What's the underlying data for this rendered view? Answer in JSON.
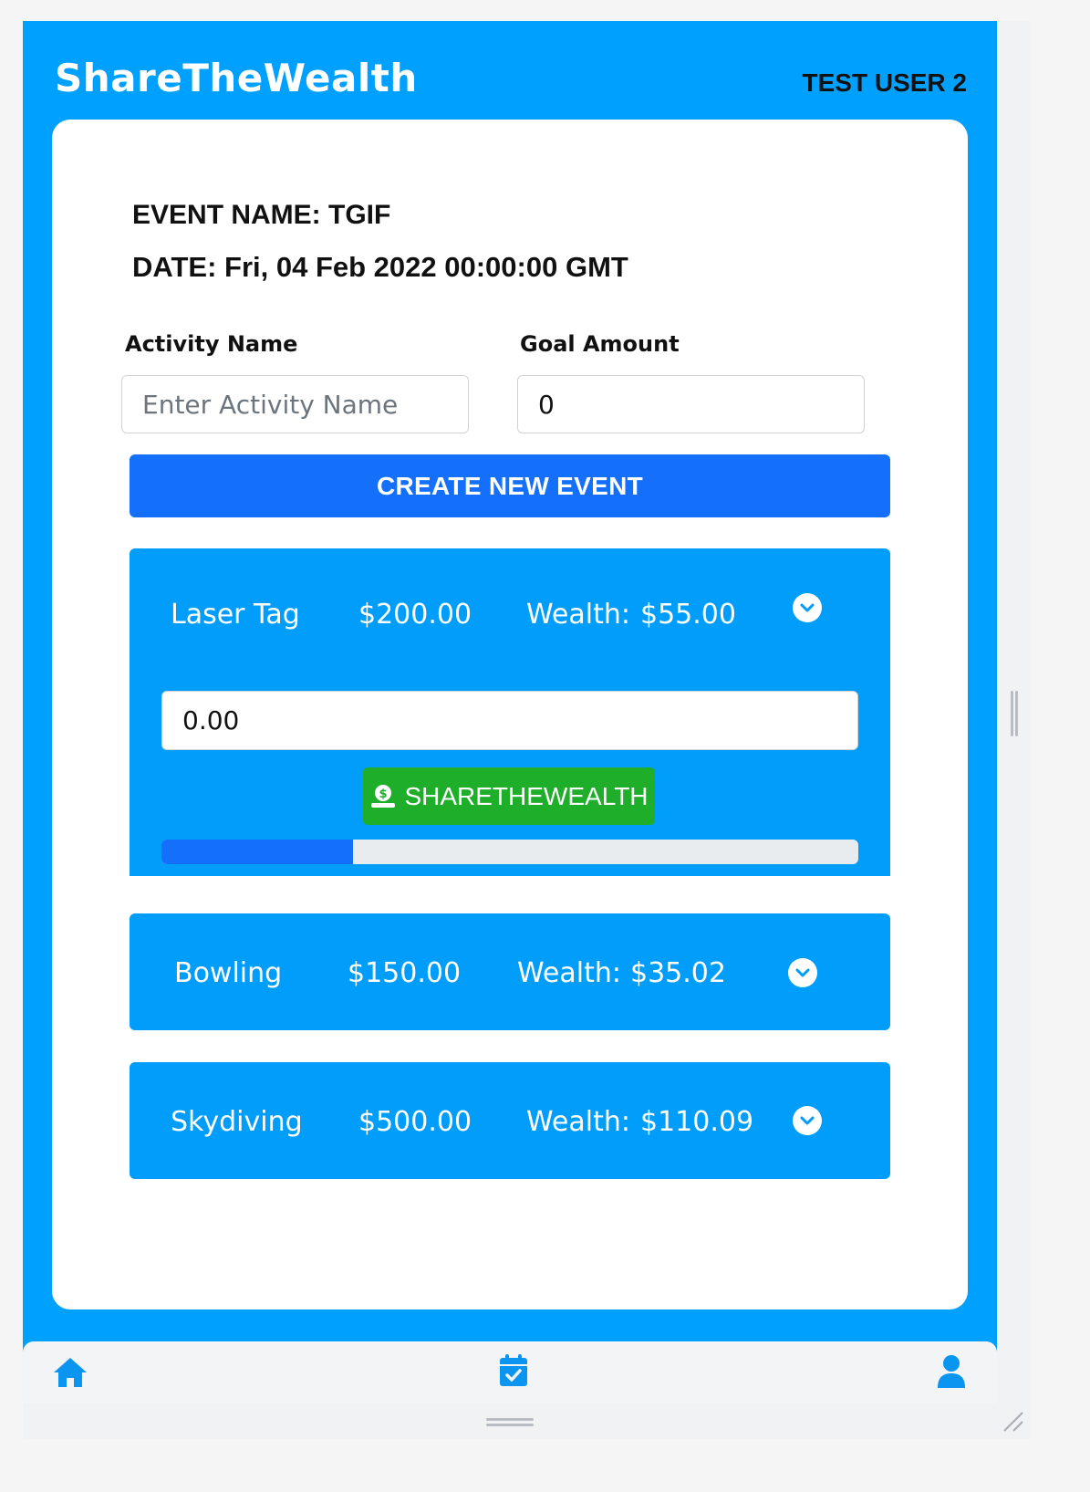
{
  "header": {
    "app_title": "ShareTheWealth",
    "user_name": "TEST USER 2"
  },
  "event": {
    "name_line": "EVENT NAME: TGIF",
    "date_line": "DATE: Fri, 04 Feb 2022 00:00:00 GMT"
  },
  "form": {
    "activity_label": "Activity Name",
    "activity_placeholder": "Enter Activity Name",
    "activity_value": "",
    "goal_label": "Goal Amount",
    "goal_value": "0",
    "create_button": "CREATE NEW EVENT"
  },
  "activities": [
    {
      "name": "Laser Tag",
      "goal": "$200.00",
      "wealth_label": "Wealth:",
      "wealth": "$55.00",
      "expanded": true,
      "contribution_value": "0.00",
      "share_button": "SHARETHEWEALTH",
      "progress_fraction": 0.275
    },
    {
      "name": "Bowling",
      "goal": "$150.00",
      "wealth_label": "Wealth:",
      "wealth": "$35.02",
      "expanded": false
    },
    {
      "name": "Skydiving",
      "goal": "$500.00",
      "wealth_label": "Wealth:",
      "wealth": "$110.09",
      "expanded": false
    }
  ],
  "bottom_nav": {
    "items": [
      {
        "icon": "home-icon"
      },
      {
        "icon": "calendar-check-icon"
      },
      {
        "icon": "user-icon"
      }
    ]
  },
  "colors": {
    "app_background": "#00a0fe",
    "activity_background": "#009dfb",
    "primary_button": "#146ffb",
    "share_button": "#1eae29",
    "progress_track": "#e9ecef"
  }
}
